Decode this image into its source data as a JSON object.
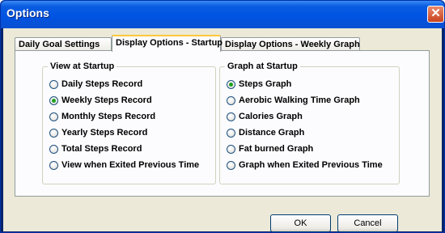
{
  "window": {
    "title": "Options",
    "close_glyph": "✕"
  },
  "tabs": [
    {
      "label": "Daily Goal Settings",
      "active": false
    },
    {
      "label": "Display Options - Startup",
      "active": true
    },
    {
      "label": "Display Options - Weekly Graph",
      "active": false
    }
  ],
  "view_group": {
    "title": "View at Startup",
    "options": [
      {
        "label": "Daily Steps Record",
        "selected": false
      },
      {
        "label": "Weekly Steps Record",
        "selected": true
      },
      {
        "label": "Monthly Steps Record",
        "selected": false
      },
      {
        "label": "Yearly Steps Record",
        "selected": false
      },
      {
        "label": "Total Steps Record",
        "selected": false
      },
      {
        "label": "View when Exited Previous Time",
        "selected": false
      }
    ]
  },
  "graph_group": {
    "title": "Graph at Startup",
    "options": [
      {
        "label": "Steps Graph",
        "selected": true
      },
      {
        "label": "Aerobic Walking Time Graph",
        "selected": false
      },
      {
        "label": "Calories Graph",
        "selected": false
      },
      {
        "label": "Distance Graph",
        "selected": false
      },
      {
        "label": "Fat burned Graph",
        "selected": false
      },
      {
        "label": "Graph when Exited Previous Time",
        "selected": false
      }
    ]
  },
  "buttons": {
    "ok": "OK",
    "cancel": "Cancel"
  }
}
